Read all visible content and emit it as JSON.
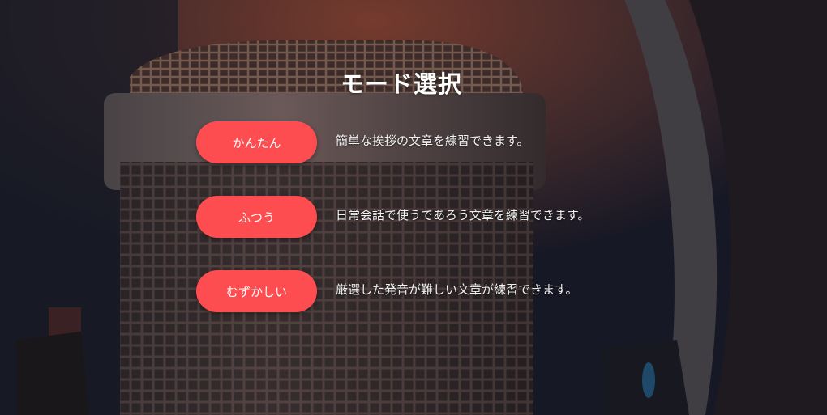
{
  "background": {
    "image": "microphone-photo",
    "accent_color": "#fd4d50"
  },
  "page": {
    "title": "モード選択"
  },
  "modes": [
    {
      "label": "かんたん",
      "description": "簡単な挨拶の文章を練習できます。"
    },
    {
      "label": "ふつう",
      "description": "日常会話で使うであろう文章を練習できます。"
    },
    {
      "label": "むずかしい",
      "description": "厳選した発音が難しい文章が練習できます。"
    }
  ]
}
